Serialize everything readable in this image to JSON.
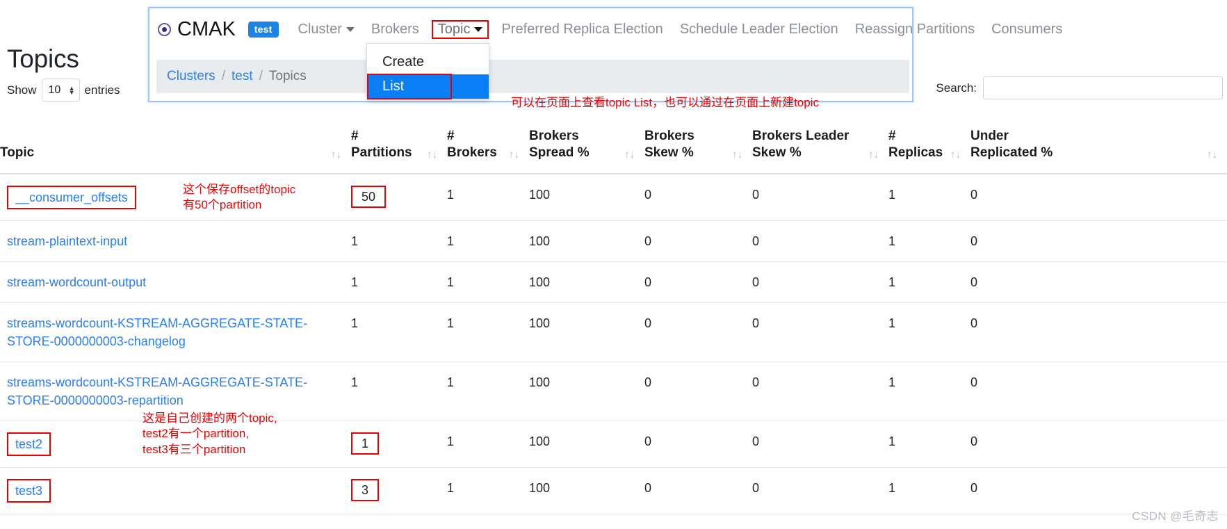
{
  "page": {
    "title": "Topics",
    "show_label": "Show",
    "entries_label": "entries",
    "entries_value": "10",
    "search_label": "Search:",
    "search_value": "",
    "search_placeholder": ""
  },
  "navbar": {
    "brand": "CMAK",
    "cluster_badge": "test",
    "items": [
      {
        "label": "Cluster",
        "caret": true,
        "boxed": false
      },
      {
        "label": "Brokers",
        "caret": false,
        "boxed": false
      },
      {
        "label": "Topic",
        "caret": true,
        "boxed": true
      },
      {
        "label": "Preferred Replica Election",
        "caret": false,
        "boxed": false
      },
      {
        "label": "Schedule Leader Election",
        "caret": false,
        "boxed": false
      },
      {
        "label": "Reassign Partitions",
        "caret": false,
        "boxed": false
      },
      {
        "label": "Consumers",
        "caret": false,
        "boxed": false
      }
    ]
  },
  "dropdown": {
    "items": [
      {
        "label": "Create",
        "active": false
      },
      {
        "label": "List",
        "active": true
      }
    ]
  },
  "breadcrumb": {
    "clusters": "Clusters",
    "cluster": "test",
    "current": "Topics",
    "separator": "/"
  },
  "annotations": {
    "nav": "可以在页面上查看topic List，也可以通过在页面上新建topic",
    "offsets": "这个保存offset的topic\n有50个partition",
    "tests": "这是自己创建的两个topic,\ntest2有一个partition,\ntest3有三个partition"
  },
  "table": {
    "sort_icon": "↑↓",
    "columns": [
      {
        "key": "topic",
        "line1": "",
        "line2": "Topic"
      },
      {
        "key": "part",
        "line1": "#",
        "line2": "Partitions"
      },
      {
        "key": "brokers",
        "line1": "#",
        "line2": "Brokers"
      },
      {
        "key": "spread",
        "line1": "Brokers",
        "line2": "Spread %"
      },
      {
        "key": "skew",
        "line1": "Brokers",
        "line2": "Skew %"
      },
      {
        "key": "lskew",
        "line1": "Brokers Leader",
        "line2": "Skew %"
      },
      {
        "key": "repl",
        "line1": "#",
        "line2": "Replicas"
      },
      {
        "key": "under",
        "line1": "Under",
        "line2": "Replicated %"
      }
    ],
    "rows": [
      {
        "topic": "__consumer_offsets",
        "topic_boxed": true,
        "partitions": "50",
        "partitions_boxed": true,
        "brokers": "1",
        "spread": "100",
        "skew": "0",
        "leader_skew": "0",
        "replicas": "1",
        "under_replicated": "0"
      },
      {
        "topic": "stream-plaintext-input",
        "topic_boxed": false,
        "partitions": "1",
        "partitions_boxed": false,
        "brokers": "1",
        "spread": "100",
        "skew": "0",
        "leader_skew": "0",
        "replicas": "1",
        "under_replicated": "0"
      },
      {
        "topic": "stream-wordcount-output",
        "topic_boxed": false,
        "partitions": "1",
        "partitions_boxed": false,
        "brokers": "1",
        "spread": "100",
        "skew": "0",
        "leader_skew": "0",
        "replicas": "1",
        "under_replicated": "0"
      },
      {
        "topic": "streams-wordcount-KSTREAM-AGGREGATE-STATE-STORE-0000000003-changelog",
        "topic_boxed": false,
        "partitions": "1",
        "partitions_boxed": false,
        "brokers": "1",
        "spread": "100",
        "skew": "0",
        "leader_skew": "0",
        "replicas": "1",
        "under_replicated": "0"
      },
      {
        "topic": "streams-wordcount-KSTREAM-AGGREGATE-STATE-STORE-0000000003-repartition",
        "topic_boxed": false,
        "partitions": "1",
        "partitions_boxed": false,
        "brokers": "1",
        "spread": "100",
        "skew": "0",
        "leader_skew": "0",
        "replicas": "1",
        "under_replicated": "0"
      },
      {
        "topic": "test2",
        "topic_boxed": true,
        "partitions": "1",
        "partitions_boxed": true,
        "brokers": "1",
        "spread": "100",
        "skew": "0",
        "leader_skew": "0",
        "replicas": "1",
        "under_replicated": "0"
      },
      {
        "topic": "test3",
        "topic_boxed": true,
        "partitions": "3",
        "partitions_boxed": true,
        "brokers": "1",
        "spread": "100",
        "skew": "0",
        "leader_skew": "0",
        "replicas": "1",
        "under_replicated": "0"
      }
    ]
  },
  "watermark": "CSDN @毛奇志",
  "colors": {
    "link": "#2a7ef7",
    "annotation": "#ee0000",
    "dropdown_active": "#0a7ef4",
    "badge": "#1b84e7",
    "navbar_border": "#9fc5f0"
  }
}
